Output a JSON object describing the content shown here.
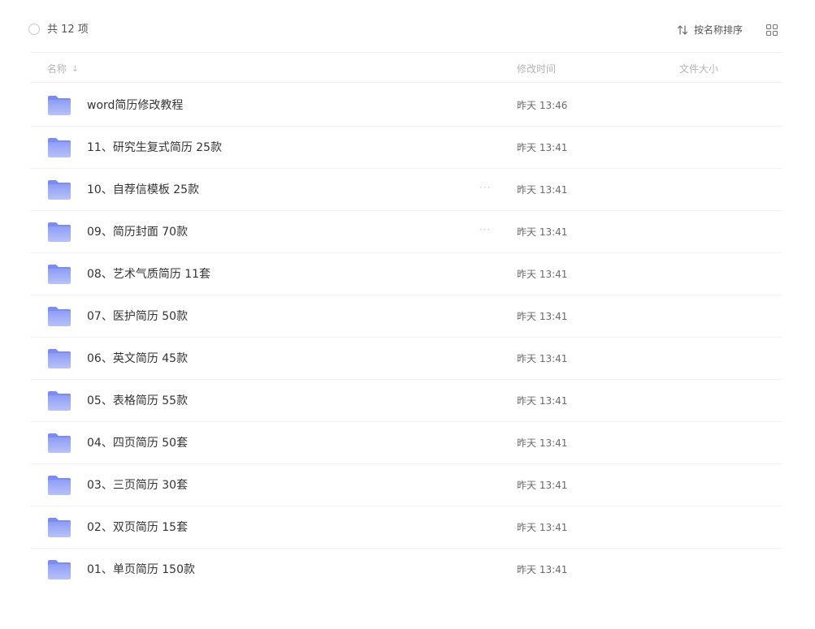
{
  "toolbar": {
    "count_label": "共 12 项",
    "sort_label": "按名称排序",
    "sort_icon": "sort-arrows-icon",
    "view_icon": "grid-view-icon"
  },
  "columns": {
    "name": "名称",
    "name_sort_icon": "arrow-down-icon",
    "modified": "修改时间",
    "size": "文件大小"
  },
  "colors": {
    "folder": "#7b8cf0",
    "folder_light": "#a9b6f7"
  },
  "files": [
    {
      "name": "word简历修改教程",
      "modified": "昨天 13:46",
      "icon": "folder-icon"
    },
    {
      "name": "11、研究生复式简历 25款",
      "modified": "昨天 13:41",
      "icon": "folder-icon"
    },
    {
      "name": "10、自荐信模板 25款",
      "modified": "昨天 13:41",
      "icon": "folder-icon",
      "more": "···"
    },
    {
      "name": "09、简历封面 70款",
      "modified": "昨天 13:41",
      "icon": "folder-icon",
      "more": "···"
    },
    {
      "name": "08、艺术气质简历 11套",
      "modified": "昨天 13:41",
      "icon": "folder-icon"
    },
    {
      "name": "07、医护简历 50款",
      "modified": "昨天 13:41",
      "icon": "folder-icon"
    },
    {
      "name": "06、英文简历 45款",
      "modified": "昨天 13:41",
      "icon": "folder-icon"
    },
    {
      "name": "05、表格简历 55款",
      "modified": "昨天 13:41",
      "icon": "folder-icon"
    },
    {
      "name": "04、四页简历 50套",
      "modified": "昨天 13:41",
      "icon": "folder-icon"
    },
    {
      "name": "03、三页简历 30套",
      "modified": "昨天 13:41",
      "icon": "folder-icon"
    },
    {
      "name": "02、双页简历 15套",
      "modified": "昨天 13:41",
      "icon": "folder-icon"
    },
    {
      "name": "01、单页简历 150款",
      "modified": "昨天 13:41",
      "icon": "folder-icon"
    }
  ]
}
